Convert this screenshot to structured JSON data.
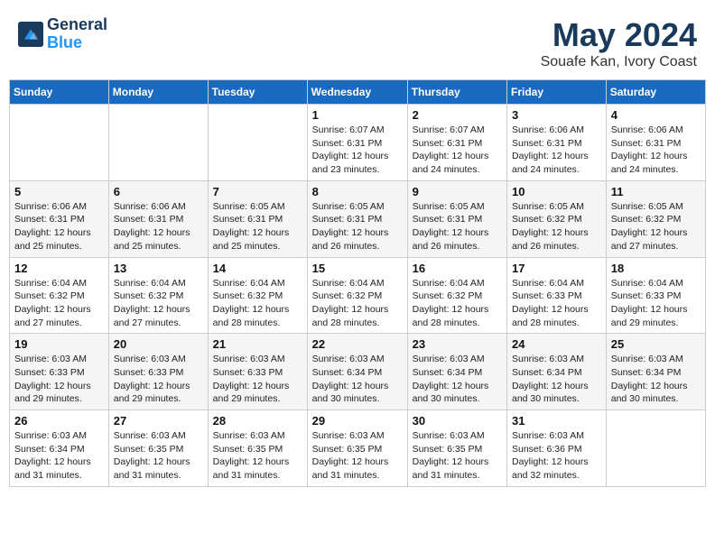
{
  "header": {
    "logo_line1": "General",
    "logo_line2": "Blue",
    "month_title": "May 2024",
    "location": "Souafe Kan, Ivory Coast"
  },
  "calendar": {
    "days_of_week": [
      "Sunday",
      "Monday",
      "Tuesday",
      "Wednesday",
      "Thursday",
      "Friday",
      "Saturday"
    ],
    "weeks": [
      [
        {
          "day": "",
          "sunrise": "",
          "sunset": "",
          "daylight": ""
        },
        {
          "day": "",
          "sunrise": "",
          "sunset": "",
          "daylight": ""
        },
        {
          "day": "",
          "sunrise": "",
          "sunset": "",
          "daylight": ""
        },
        {
          "day": "1",
          "sunrise": "Sunrise: 6:07 AM",
          "sunset": "Sunset: 6:31 PM",
          "daylight": "Daylight: 12 hours and 23 minutes."
        },
        {
          "day": "2",
          "sunrise": "Sunrise: 6:07 AM",
          "sunset": "Sunset: 6:31 PM",
          "daylight": "Daylight: 12 hours and 24 minutes."
        },
        {
          "day": "3",
          "sunrise": "Sunrise: 6:06 AM",
          "sunset": "Sunset: 6:31 PM",
          "daylight": "Daylight: 12 hours and 24 minutes."
        },
        {
          "day": "4",
          "sunrise": "Sunrise: 6:06 AM",
          "sunset": "Sunset: 6:31 PM",
          "daylight": "Daylight: 12 hours and 24 minutes."
        }
      ],
      [
        {
          "day": "5",
          "sunrise": "Sunrise: 6:06 AM",
          "sunset": "Sunset: 6:31 PM",
          "daylight": "Daylight: 12 hours and 25 minutes."
        },
        {
          "day": "6",
          "sunrise": "Sunrise: 6:06 AM",
          "sunset": "Sunset: 6:31 PM",
          "daylight": "Daylight: 12 hours and 25 minutes."
        },
        {
          "day": "7",
          "sunrise": "Sunrise: 6:05 AM",
          "sunset": "Sunset: 6:31 PM",
          "daylight": "Daylight: 12 hours and 25 minutes."
        },
        {
          "day": "8",
          "sunrise": "Sunrise: 6:05 AM",
          "sunset": "Sunset: 6:31 PM",
          "daylight": "Daylight: 12 hours and 26 minutes."
        },
        {
          "day": "9",
          "sunrise": "Sunrise: 6:05 AM",
          "sunset": "Sunset: 6:31 PM",
          "daylight": "Daylight: 12 hours and 26 minutes."
        },
        {
          "day": "10",
          "sunrise": "Sunrise: 6:05 AM",
          "sunset": "Sunset: 6:32 PM",
          "daylight": "Daylight: 12 hours and 26 minutes."
        },
        {
          "day": "11",
          "sunrise": "Sunrise: 6:05 AM",
          "sunset": "Sunset: 6:32 PM",
          "daylight": "Daylight: 12 hours and 27 minutes."
        }
      ],
      [
        {
          "day": "12",
          "sunrise": "Sunrise: 6:04 AM",
          "sunset": "Sunset: 6:32 PM",
          "daylight": "Daylight: 12 hours and 27 minutes."
        },
        {
          "day": "13",
          "sunrise": "Sunrise: 6:04 AM",
          "sunset": "Sunset: 6:32 PM",
          "daylight": "Daylight: 12 hours and 27 minutes."
        },
        {
          "day": "14",
          "sunrise": "Sunrise: 6:04 AM",
          "sunset": "Sunset: 6:32 PM",
          "daylight": "Daylight: 12 hours and 28 minutes."
        },
        {
          "day": "15",
          "sunrise": "Sunrise: 6:04 AM",
          "sunset": "Sunset: 6:32 PM",
          "daylight": "Daylight: 12 hours and 28 minutes."
        },
        {
          "day": "16",
          "sunrise": "Sunrise: 6:04 AM",
          "sunset": "Sunset: 6:32 PM",
          "daylight": "Daylight: 12 hours and 28 minutes."
        },
        {
          "day": "17",
          "sunrise": "Sunrise: 6:04 AM",
          "sunset": "Sunset: 6:33 PM",
          "daylight": "Daylight: 12 hours and 28 minutes."
        },
        {
          "day": "18",
          "sunrise": "Sunrise: 6:04 AM",
          "sunset": "Sunset: 6:33 PM",
          "daylight": "Daylight: 12 hours and 29 minutes."
        }
      ],
      [
        {
          "day": "19",
          "sunrise": "Sunrise: 6:03 AM",
          "sunset": "Sunset: 6:33 PM",
          "daylight": "Daylight: 12 hours and 29 minutes."
        },
        {
          "day": "20",
          "sunrise": "Sunrise: 6:03 AM",
          "sunset": "Sunset: 6:33 PM",
          "daylight": "Daylight: 12 hours and 29 minutes."
        },
        {
          "day": "21",
          "sunrise": "Sunrise: 6:03 AM",
          "sunset": "Sunset: 6:33 PM",
          "daylight": "Daylight: 12 hours and 29 minutes."
        },
        {
          "day": "22",
          "sunrise": "Sunrise: 6:03 AM",
          "sunset": "Sunset: 6:34 PM",
          "daylight": "Daylight: 12 hours and 30 minutes."
        },
        {
          "day": "23",
          "sunrise": "Sunrise: 6:03 AM",
          "sunset": "Sunset: 6:34 PM",
          "daylight": "Daylight: 12 hours and 30 minutes."
        },
        {
          "day": "24",
          "sunrise": "Sunrise: 6:03 AM",
          "sunset": "Sunset: 6:34 PM",
          "daylight": "Daylight: 12 hours and 30 minutes."
        },
        {
          "day": "25",
          "sunrise": "Sunrise: 6:03 AM",
          "sunset": "Sunset: 6:34 PM",
          "daylight": "Daylight: 12 hours and 30 minutes."
        }
      ],
      [
        {
          "day": "26",
          "sunrise": "Sunrise: 6:03 AM",
          "sunset": "Sunset: 6:34 PM",
          "daylight": "Daylight: 12 hours and 31 minutes."
        },
        {
          "day": "27",
          "sunrise": "Sunrise: 6:03 AM",
          "sunset": "Sunset: 6:35 PM",
          "daylight": "Daylight: 12 hours and 31 minutes."
        },
        {
          "day": "28",
          "sunrise": "Sunrise: 6:03 AM",
          "sunset": "Sunset: 6:35 PM",
          "daylight": "Daylight: 12 hours and 31 minutes."
        },
        {
          "day": "29",
          "sunrise": "Sunrise: 6:03 AM",
          "sunset": "Sunset: 6:35 PM",
          "daylight": "Daylight: 12 hours and 31 minutes."
        },
        {
          "day": "30",
          "sunrise": "Sunrise: 6:03 AM",
          "sunset": "Sunset: 6:35 PM",
          "daylight": "Daylight: 12 hours and 31 minutes."
        },
        {
          "day": "31",
          "sunrise": "Sunrise: 6:03 AM",
          "sunset": "Sunset: 6:36 PM",
          "daylight": "Daylight: 12 hours and 32 minutes."
        },
        {
          "day": "",
          "sunrise": "",
          "sunset": "",
          "daylight": ""
        }
      ]
    ]
  }
}
